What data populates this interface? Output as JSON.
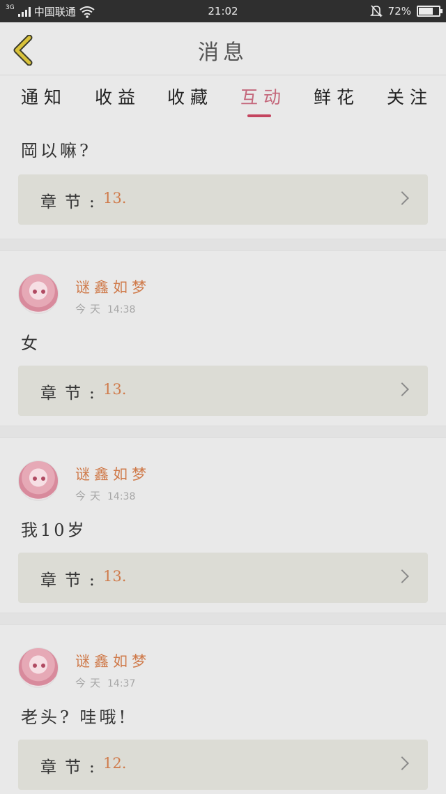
{
  "status_bar": {
    "network": "3G",
    "carrier": "中国联通",
    "time": "21:02",
    "battery_percent": "72%",
    "battery_level": 0.72,
    "icons": [
      "signal-icon",
      "wifi-icon",
      "mute-bell-icon",
      "battery-icon"
    ]
  },
  "header": {
    "title": "消息",
    "back_icon": "chevron-left-icon",
    "accent_color": "#d9c23a"
  },
  "tabs": {
    "items": [
      "通知",
      "收益",
      "收藏",
      "互动",
      "鲜花",
      "关注"
    ],
    "active_index": 3,
    "active_color": "#c4455f"
  },
  "feed": {
    "chapter_label": "章节:",
    "items": [
      {
        "message": "岡以嘛?",
        "chapter": "13."
      },
      {
        "username": "谜鑫如梦",
        "time_prefix": "今天",
        "time": "14:38",
        "message": "女",
        "chapter": "13."
      },
      {
        "username": "谜鑫如梦",
        "time_prefix": "今天",
        "time": "14:38",
        "message": "我10岁",
        "chapter": "13."
      },
      {
        "username": "谜鑫如梦",
        "time_prefix": "今天",
        "time": "14:37",
        "message": "老头? 哇哦!",
        "chapter": "12."
      }
    ]
  }
}
